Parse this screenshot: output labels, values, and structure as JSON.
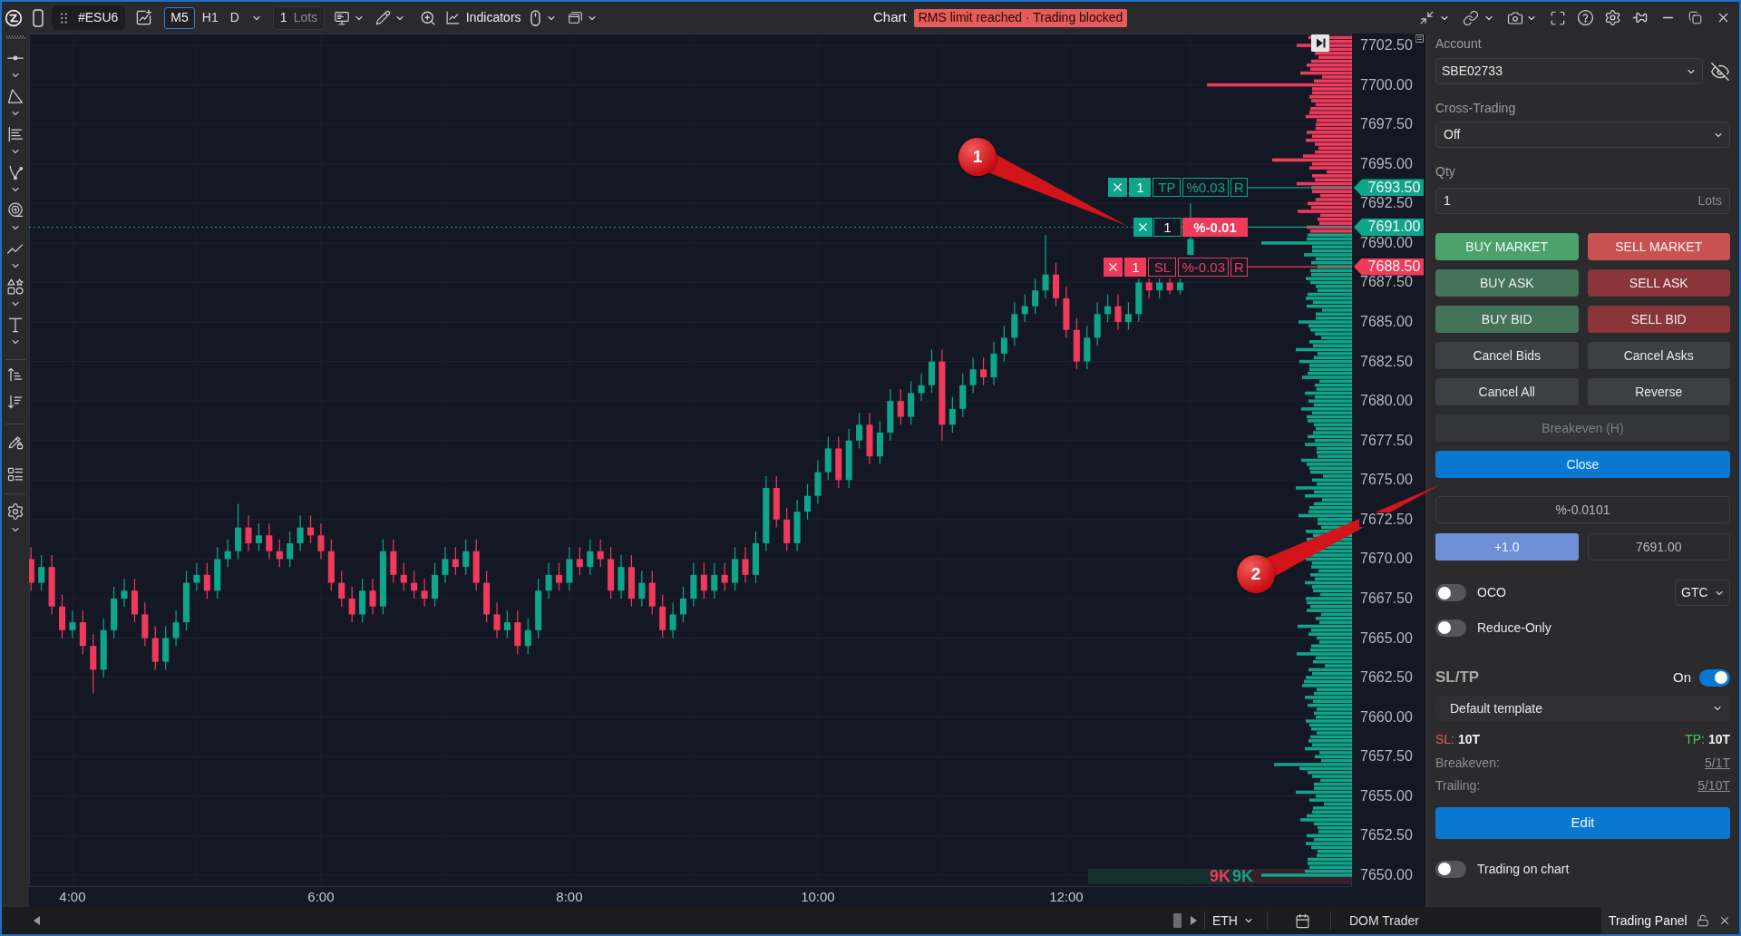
{
  "top_bar": {
    "symbol": "#ESU6",
    "timeframes": [
      {
        "label": "M5",
        "selected": true
      },
      {
        "label": "H1",
        "selected": false
      },
      {
        "label": "D",
        "selected": false
      }
    ],
    "quantity": {
      "value": "1",
      "unit": "Lots"
    },
    "indicators": "Indicators",
    "title": "Chart",
    "alert": "RMS limit reached · Trading blocked"
  },
  "chart": {
    "chart_data": [
      {
        "type": "candlestick",
        "xlim": [
          3.65,
          14.3
        ],
        "ylim": [
          7649.25,
          7703.25
        ],
        "grid": true,
        "xticks": [
          {
            "value": 4,
            "label": "4:00"
          },
          {
            "value": 6,
            "label": "6:00"
          },
          {
            "value": 8,
            "label": "8:00"
          },
          {
            "value": 10,
            "label": "10:00"
          },
          {
            "value": 12,
            "label": "12:00"
          }
        ],
        "yticks": [
          {
            "value": 7650,
            "label": "7650.00"
          },
          {
            "value": 7652.5,
            "label": "7652.50"
          },
          {
            "value": 7655,
            "label": "7655.00"
          },
          {
            "value": 7657.5,
            "label": "7657.50"
          },
          {
            "value": 7660,
            "label": "7660.00"
          },
          {
            "value": 7662.5,
            "label": "7662.50"
          },
          {
            "value": 7665,
            "label": "7665.00"
          },
          {
            "value": 7667.5,
            "label": "7667.50"
          },
          {
            "value": 7670,
            "label": "7670.00"
          },
          {
            "value": 7672.5,
            "label": "7672.50"
          },
          {
            "value": 7675,
            "label": "7675.00"
          },
          {
            "value": 7677.5,
            "label": "7677.50"
          },
          {
            "value": 7680,
            "label": "7680.00"
          },
          {
            "value": 7682.5,
            "label": "7682.50"
          },
          {
            "value": 7685,
            "label": "7685.00"
          },
          {
            "value": 7687.5,
            "label": "7687.50"
          },
          {
            "value": 7690,
            "label": "7690.00"
          },
          {
            "value": 7692.5,
            "label": "7692.50"
          },
          {
            "value": 7695,
            "label": "7695.00"
          },
          {
            "value": 7697.5,
            "label": "7697.50"
          },
          {
            "value": 7700,
            "label": "7700.00"
          },
          {
            "value": 7702.5,
            "label": "7702.50"
          }
        ],
        "ref_lines": [
          {
            "axis": "y",
            "value": 7693.5,
            "label": "7693.50",
            "color": "#0ea58a",
            "line_style": "solid"
          },
          {
            "axis": "y",
            "value": 7691,
            "label": "7691.00",
            "color": "#0ea58a",
            "line_style": "dotted"
          },
          {
            "axis": "y",
            "value": 7688.5,
            "label": "7688.50",
            "color": "#ef3a5c",
            "line_style": "solid"
          }
        ],
        "x": [
          3.6667,
          3.75,
          3.8333,
          3.9167,
          4,
          4.0833,
          4.1667,
          4.25,
          4.3333,
          4.4167,
          4.5,
          4.5833,
          4.6667,
          4.75,
          4.8333,
          4.9167,
          5,
          5.0833,
          5.1667,
          5.25,
          5.3333,
          5.4167,
          5.5,
          5.5833,
          5.6667,
          5.75,
          5.8333,
          5.9167,
          6,
          6.0833,
          6.1667,
          6.25,
          6.3333,
          6.4167,
          6.5,
          6.5833,
          6.6667,
          6.75,
          6.8333,
          6.9167,
          7,
          7.0833,
          7.1667,
          7.25,
          7.3333,
          7.4167,
          7.5,
          7.5833,
          7.6667,
          7.75,
          7.8333,
          7.9167,
          8,
          8.0833,
          8.1667,
          8.25,
          8.3333,
          8.4167,
          8.5,
          8.5833,
          8.6667,
          8.75,
          8.8333,
          8.9167,
          9,
          9.0833,
          9.1667,
          9.25,
          9.3333,
          9.4167,
          9.5,
          9.5833,
          9.6667,
          9.75,
          9.8333,
          9.9167,
          10,
          10.0833,
          10.1667,
          10.25,
          10.3333,
          10.4167,
          10.5,
          10.5833,
          10.6667,
          10.75,
          10.8333,
          10.9167,
          11,
          11.0833,
          11.1667,
          11.25,
          11.3333,
          11.4167,
          11.5,
          11.5833,
          11.6667,
          11.75,
          11.8333,
          11.9167,
          12,
          12.0833,
          12.1667,
          12.25,
          12.3333,
          12.4167,
          12.5,
          12.5833,
          12.6667,
          12.75,
          12.8333,
          12.9167,
          13
        ],
        "ohlc": [
          [
            7670,
            7670.75,
            7668,
            7668.5
          ],
          [
            7668.5,
            7670.25,
            7668,
            7669.5
          ],
          [
            7669.5,
            7670.25,
            7666.5,
            7667
          ],
          [
            7667,
            7667.75,
            7665,
            7665.5
          ],
          [
            7665.5,
            7666.75,
            7665,
            7666
          ],
          [
            7666,
            7666.75,
            7664,
            7664.5
          ],
          [
            7664.5,
            7665.25,
            7661.5,
            7663
          ],
          [
            7663,
            7666.25,
            7662.5,
            7665.5
          ],
          [
            7665.5,
            7668.25,
            7665,
            7667.5
          ],
          [
            7667.5,
            7668.75,
            7667,
            7668
          ],
          [
            7668,
            7668.75,
            7666,
            7666.5
          ],
          [
            7666.5,
            7667.25,
            7664.5,
            7665
          ],
          [
            7665,
            7665.75,
            7663,
            7663.5
          ],
          [
            7663.5,
            7665.75,
            7663,
            7665
          ],
          [
            7665,
            7666.75,
            7664.5,
            7666
          ],
          [
            7666,
            7669.25,
            7665.5,
            7668.5
          ],
          [
            7668.5,
            7669.75,
            7668,
            7669
          ],
          [
            7669,
            7669.75,
            7667.5,
            7668
          ],
          [
            7668,
            7670.75,
            7667.5,
            7670
          ],
          [
            7670,
            7671.25,
            7669.5,
            7670.5
          ],
          [
            7670.5,
            7673.5,
            7670,
            7672
          ],
          [
            7672,
            7672.75,
            7670.5,
            7671
          ],
          [
            7671,
            7672.25,
            7670.5,
            7671.5
          ],
          [
            7671.5,
            7672.25,
            7670,
            7670.5
          ],
          [
            7670.5,
            7671.25,
            7669.5,
            7670
          ],
          [
            7670,
            7671.75,
            7669.5,
            7671
          ],
          [
            7671,
            7672.75,
            7670.5,
            7672
          ],
          [
            7672,
            7672.75,
            7671,
            7671.5
          ],
          [
            7671.5,
            7672.25,
            7670,
            7670.5
          ],
          [
            7670.5,
            7671.25,
            7668,
            7668.5
          ],
          [
            7668.5,
            7669.25,
            7667,
            7667.5
          ],
          [
            7667.5,
            7668.25,
            7666,
            7666.5
          ],
          [
            7666.5,
            7668.75,
            7666,
            7668
          ],
          [
            7668,
            7668.75,
            7666.5,
            7667
          ],
          [
            7667,
            7671.25,
            7666.5,
            7670.5
          ],
          [
            7670.5,
            7671.25,
            7668.5,
            7669
          ],
          [
            7669,
            7669.75,
            7668,
            7668.5
          ],
          [
            7668.5,
            7669.25,
            7667.5,
            7668
          ],
          [
            7668,
            7668.75,
            7667,
            7667.5
          ],
          [
            7667.5,
            7669.75,
            7667,
            7669
          ],
          [
            7669,
            7670.75,
            7668.5,
            7670
          ],
          [
            7670,
            7670.75,
            7669,
            7669.5
          ],
          [
            7669.5,
            7671.25,
            7669,
            7670.5
          ],
          [
            7670.5,
            7671.25,
            7668,
            7668.5
          ],
          [
            7668.5,
            7669.25,
            7666,
            7666.5
          ],
          [
            7666.5,
            7667.25,
            7665,
            7665.5
          ],
          [
            7665.5,
            7666.75,
            7665,
            7666
          ],
          [
            7666,
            7666.75,
            7664,
            7664.5
          ],
          [
            7664.5,
            7666.25,
            7664,
            7665.5
          ],
          [
            7665.5,
            7668.75,
            7665,
            7668
          ],
          [
            7668,
            7669.75,
            7667.5,
            7669
          ],
          [
            7669,
            7669.75,
            7668,
            7668.5
          ],
          [
            7668.5,
            7670.75,
            7668,
            7670
          ],
          [
            7670,
            7670.75,
            7669,
            7669.5
          ],
          [
            7669.5,
            7671.25,
            7669,
            7670.5
          ],
          [
            7670.5,
            7671.25,
            7669.5,
            7670
          ],
          [
            7670,
            7670.75,
            7667.5,
            7668
          ],
          [
            7668,
            7670.25,
            7667.5,
            7669.5
          ],
          [
            7669.5,
            7670.25,
            7667,
            7667.5
          ],
          [
            7667.5,
            7669.25,
            7667,
            7668.5
          ],
          [
            7668.5,
            7669.25,
            7666.5,
            7667
          ],
          [
            7667,
            7667.75,
            7665,
            7665.5
          ],
          [
            7665.5,
            7667.25,
            7665,
            7666.5
          ],
          [
            7666.5,
            7668.25,
            7666,
            7667.5
          ],
          [
            7667.5,
            7669.75,
            7667,
            7669
          ],
          [
            7669,
            7669.75,
            7667.5,
            7668
          ],
          [
            7668,
            7669.75,
            7667.5,
            7669
          ],
          [
            7669,
            7669.75,
            7668,
            7668.5
          ],
          [
            7668.5,
            7670.75,
            7668,
            7670
          ],
          [
            7670,
            7670.75,
            7668.5,
            7669
          ],
          [
            7669,
            7671.75,
            7668.5,
            7671
          ],
          [
            7671,
            7675.25,
            7670.5,
            7674.5
          ],
          [
            7674.5,
            7675.25,
            7672,
            7672.5
          ],
          [
            7672.5,
            7673.25,
            7670.5,
            7671
          ],
          [
            7671,
            7673.75,
            7670.5,
            7673
          ],
          [
            7673,
            7674.75,
            7672.5,
            7674
          ],
          [
            7674,
            7676.25,
            7673.5,
            7675.5
          ],
          [
            7675.5,
            7677.75,
            7675,
            7677
          ],
          [
            7677,
            7677.75,
            7674.5,
            7675
          ],
          [
            7675,
            7678.25,
            7674.5,
            7677.5
          ],
          [
            7677.5,
            7679.25,
            7677,
            7678.5
          ],
          [
            7678.5,
            7679.25,
            7676,
            7676.5
          ],
          [
            7676.5,
            7678.75,
            7676,
            7678
          ],
          [
            7678,
            7680.75,
            7677.5,
            7680
          ],
          [
            7680,
            7680.75,
            7678.5,
            7679
          ],
          [
            7679,
            7681.25,
            7678.5,
            7680.5
          ],
          [
            7680.5,
            7681.75,
            7680,
            7681
          ],
          [
            7681,
            7683.25,
            7680.5,
            7682.5
          ],
          [
            7682.5,
            7683.25,
            7677.5,
            7678.5
          ],
          [
            7678.5,
            7680.25,
            7678,
            7679.5
          ],
          [
            7679.5,
            7681.75,
            7679,
            7681
          ],
          [
            7681,
            7682.75,
            7680.5,
            7682
          ],
          [
            7682,
            7682.75,
            7681,
            7681.5
          ],
          [
            7681.5,
            7683.75,
            7681,
            7683
          ],
          [
            7683,
            7684.75,
            7682.5,
            7684
          ],
          [
            7684,
            7686.25,
            7683.5,
            7685.5
          ],
          [
            7685.5,
            7686.75,
            7685,
            7686
          ],
          [
            7686,
            7687.75,
            7685.5,
            7687
          ],
          [
            7687,
            7690.5,
            7686.5,
            7688
          ],
          [
            7688,
            7688.75,
            7686,
            7686.5
          ],
          [
            7686.5,
            7687.25,
            7684,
            7684.5
          ],
          [
            7684.5,
            7685.25,
            7682,
            7682.5
          ],
          [
            7682.5,
            7684.75,
            7682,
            7684
          ],
          [
            7684,
            7686.25,
            7683.5,
            7685.5
          ],
          [
            7685.5,
            7686.75,
            7685,
            7686
          ],
          [
            7686,
            7686.75,
            7684.5,
            7685
          ],
          [
            7685,
            7686.25,
            7684.5,
            7685.5
          ],
          [
            7685.5,
            7687.75,
            7685,
            7687.5
          ],
          [
            7687.5,
            7687.75,
            7686.5,
            7687
          ],
          [
            7687,
            7687.75,
            7686.5,
            7687.5
          ],
          [
            7687.5,
            7687.75,
            7686.75,
            7687
          ],
          [
            7687,
            7687.75,
            7686.75,
            7687.5
          ],
          [
            7689.25,
            7692.5,
            7689.25,
            7690.25
          ]
        ],
        "colors": [
          "#ef3a5c",
          "#0ea58a",
          "#ef3a5c",
          "#ef3a5c",
          "#0ea58a",
          "#ef3a5c",
          "#ef3a5c",
          "#0ea58a",
          "#0ea58a",
          "#0ea58a",
          "#ef3a5c",
          "#ef3a5c",
          "#ef3a5c",
          "#0ea58a",
          "#0ea58a",
          "#0ea58a",
          "#0ea58a",
          "#ef3a5c",
          "#0ea58a",
          "#0ea58a",
          "#0ea58a",
          "#ef3a5c",
          "#0ea58a",
          "#ef3a5c",
          "#ef3a5c",
          "#0ea58a",
          "#0ea58a",
          "#ef3a5c",
          "#ef3a5c",
          "#ef3a5c",
          "#ef3a5c",
          "#ef3a5c",
          "#0ea58a",
          "#ef3a5c",
          "#0ea58a",
          "#ef3a5c",
          "#ef3a5c",
          "#ef3a5c",
          "#ef3a5c",
          "#0ea58a",
          "#0ea58a",
          "#ef3a5c",
          "#0ea58a",
          "#ef3a5c",
          "#ef3a5c",
          "#ef3a5c",
          "#0ea58a",
          "#ef3a5c",
          "#0ea58a",
          "#0ea58a",
          "#0ea58a",
          "#ef3a5c",
          "#0ea58a",
          "#ef3a5c",
          "#0ea58a",
          "#ef3a5c",
          "#ef3a5c",
          "#0ea58a",
          "#ef3a5c",
          "#0ea58a",
          "#ef3a5c",
          "#ef3a5c",
          "#0ea58a",
          "#0ea58a",
          "#0ea58a",
          "#ef3a5c",
          "#0ea58a",
          "#ef3a5c",
          "#0ea58a",
          "#ef3a5c",
          "#0ea58a",
          "#0ea58a",
          "#ef3a5c",
          "#ef3a5c",
          "#0ea58a",
          "#0ea58a",
          "#0ea58a",
          "#0ea58a",
          "#ef3a5c",
          "#0ea58a",
          "#0ea58a",
          "#ef3a5c",
          "#0ea58a",
          "#0ea58a",
          "#ef3a5c",
          "#0ea58a",
          "#0ea58a",
          "#0ea58a",
          "#ef3a5c",
          "#0ea58a",
          "#0ea58a",
          "#0ea58a",
          "#ef3a5c",
          "#0ea58a",
          "#0ea58a",
          "#0ea58a",
          "#0ea58a",
          "#0ea58a",
          "#0ea58a",
          "#ef3a5c",
          "#ef3a5c",
          "#ef3a5c",
          "#0ea58a",
          "#0ea58a",
          "#0ea58a",
          "#ef3a5c",
          "#0ea58a",
          "#0ea58a",
          "#ef3a5c",
          "#0ea58a",
          "#ef3a5c",
          "#0ea58a",
          "#0ea58a"
        ]
      }
    ],
    "volume_readout": [
      {
        "kind": "sell",
        "value": "9K"
      },
      {
        "kind": "buy",
        "value": "9K"
      }
    ],
    "order_labels": [
      {
        "kind": "take_profit",
        "quantity": "1",
        "tag": "TP",
        "pnl": "%0.03",
        "reverse": "R"
      },
      {
        "kind": "position",
        "quantity": "1",
        "pnl": "%-0.01"
      },
      {
        "kind": "stop_loss",
        "quantity": "1",
        "tag": "SL",
        "pnl": "%-0.03",
        "reverse": "R"
      }
    ],
    "callouts": [
      {
        "label": "1"
      },
      {
        "label": "2"
      }
    ]
  },
  "trading_panel": {
    "account": {
      "label": "Account",
      "value": "SBE02733"
    },
    "cross_trading": {
      "label": "Cross-Trading",
      "value": "Off"
    },
    "quantity": {
      "label": "Qty",
      "value": "1",
      "unit": "Lots"
    },
    "actions": [
      {
        "label": "BUY MARKET",
        "kind": "buy_market",
        "disabled": false
      },
      {
        "label": "SELL MARKET",
        "kind": "sell_market",
        "disabled": false
      },
      {
        "label": "BUY ASK",
        "kind": "buy_limit",
        "disabled": false
      },
      {
        "label": "SELL ASK",
        "kind": "sell_limit",
        "disabled": false
      },
      {
        "label": "BUY BID",
        "kind": "buy_limit",
        "disabled": false
      },
      {
        "label": "SELL BID",
        "kind": "sell_limit",
        "disabled": false
      },
      {
        "label": "Cancel Bids",
        "kind": "neutral",
        "disabled": false
      },
      {
        "label": "Cancel Asks",
        "kind": "neutral",
        "disabled": false
      },
      {
        "label": "Cancel All",
        "kind": "neutral",
        "disabled": false
      },
      {
        "label": "Reverse",
        "kind": "neutral",
        "disabled": false
      }
    ],
    "position_actions": [
      {
        "label": "Breakeven (H)",
        "kind": "neutral",
        "disabled": true
      },
      {
        "label": "Close",
        "kind": "primary",
        "disabled": false
      }
    ],
    "offset": "%-0.0101",
    "step": "+1.0",
    "price": "7691.00",
    "oco": {
      "label": "OCO",
      "on": false
    },
    "time_in_force": "GTC",
    "reduce_only": {
      "label": "Reduce-Only",
      "on": false
    },
    "sl_tp": {
      "title": "SL/TP",
      "status": "On",
      "on": true,
      "template": "Default template",
      "stop_loss": {
        "label": "SL:",
        "value": "10T"
      },
      "take_profit": {
        "label": "TP:",
        "value": "10T"
      },
      "rules": [
        {
          "label": "Breakeven:",
          "value": "5/1T"
        },
        {
          "label": "Trailing:",
          "value": "5/10T"
        }
      ],
      "edit": "Edit"
    },
    "trading_on_chart": {
      "label": "Trading on chart",
      "on": false
    }
  },
  "bottom_bar": {
    "session": "ETH",
    "tabs": [
      {
        "label": "DOM Trader",
        "selected": false
      },
      {
        "label": "Trading Panel",
        "selected": true
      }
    ]
  }
}
